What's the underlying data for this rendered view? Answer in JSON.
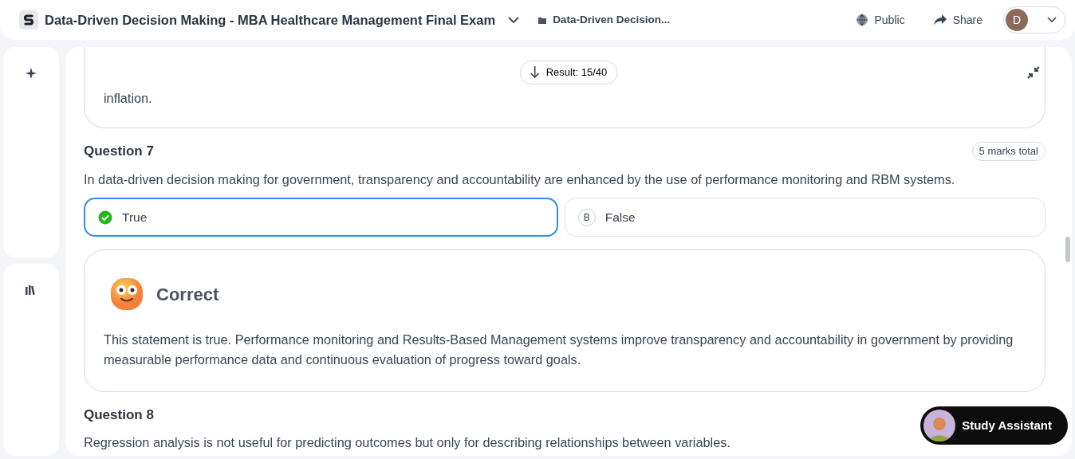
{
  "header": {
    "title": "Data-Driven Decision Making - MBA Healthcare Management Final Exam",
    "breadcrumb": "Data-Driven Decision...",
    "visibility": "Public",
    "share": "Share",
    "user_initial": "D"
  },
  "result_button": "Result: 15/40",
  "previous_explanation": "inflation.",
  "questions": [
    {
      "title": "Question 7",
      "marks": "5 marks total",
      "text": "In data-driven decision making for government, transparency and accountability are enhanced by the use of performance monitoring and RBM systems.",
      "options": [
        {
          "label": "True",
          "selected": true
        },
        {
          "letter": "B",
          "label": "False",
          "selected": false
        }
      ],
      "feedback": {
        "verdict": "Correct",
        "text": "This statement is true. Performance monitoring and Results-Based Management systems improve transparency and accountability in government by providing measurable performance data and continuous evaluation of progress toward goals."
      }
    },
    {
      "title": "Question 8",
      "text": "Regression analysis is not useful for predicting outcomes but only for describing relationships between variables."
    }
  ],
  "assistant": {
    "label": "Study Assistant"
  }
}
